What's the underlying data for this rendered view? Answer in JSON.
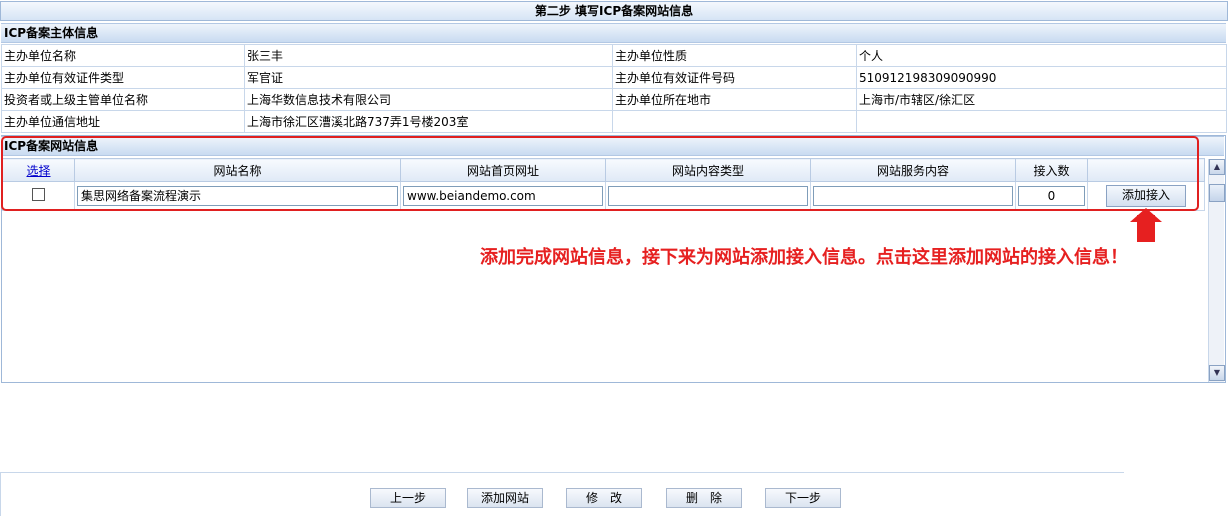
{
  "step_title": "第二步 填写ICP备案网站信息",
  "entity_section_title": "ICP备案主体信息",
  "entity_rows": [
    {
      "label1": "主办单位名称",
      "value1": "张三丰",
      "label2": "主办单位性质",
      "value2": "个人"
    },
    {
      "label1": "主办单位有效证件类型",
      "value1": "军官证",
      "label2": "主办单位有效证件号码",
      "value2": "510912198309090990"
    },
    {
      "label1": "投资者或上级主管单位名称",
      "value1": "上海华数信息技术有限公司",
      "label2": "主办单位所在地市",
      "value2": "上海市/市辖区/徐汇区"
    },
    {
      "label1": "主办单位通信地址",
      "value1": "上海市徐汇区漕溪北路737弄1号楼203室",
      "label2": "",
      "value2": ""
    }
  ],
  "site_section_title": "ICP备案网站信息",
  "site_columns": {
    "select": "选择",
    "name": "网站名称",
    "url": "网站首页网址",
    "content_type": "网站内容类型",
    "service": "网站服务内容",
    "access_count": "接入数"
  },
  "site_rows": [
    {
      "name": "集思网络备案流程演示",
      "url": "www.beiandemo.com",
      "content_type": "",
      "service": "",
      "access_count": "0",
      "action_label": "添加接入"
    }
  ],
  "annotation_text": "添加完成网站信息，接下来为网站添加接入信息。点击这里添加网站的接入信息！",
  "annotation_color": "#e62020",
  "bottom_buttons": {
    "prev": "上一步",
    "add_site": "添加网站",
    "edit": "修　改",
    "delete": "删　除",
    "next": "下一步"
  }
}
